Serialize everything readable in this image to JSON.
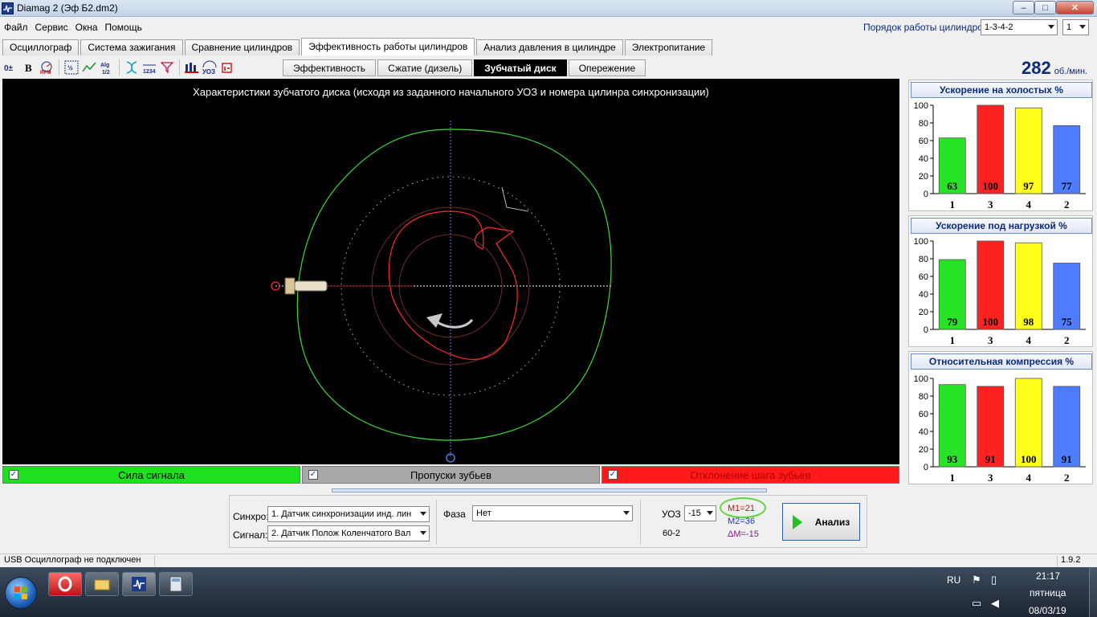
{
  "window": {
    "title": "Diamag 2 (Эф Б2.dm2)",
    "minimize": "‒",
    "maximize": "□",
    "close": "✕"
  },
  "menu": [
    "Файл",
    "Сервис",
    "Окна",
    "Помощь"
  ],
  "firing_order": {
    "label": "Порядок работы цилиндров",
    "value": "1-3-4-2",
    "spinner": "1"
  },
  "main_tabs": [
    "Осциллограф",
    "Система зажигания",
    "Сравнение цилиндров",
    "Эффективность работы цилиндров",
    "Анализ давления в цилиндре",
    "Электропитание"
  ],
  "main_tab_active": "Эффективность работы цилиндров",
  "toolbar": [
    "0±",
    "B",
    "RPM",
    "1/2",
    "~",
    "Alg",
    "dna",
    "1234",
    "filter",
    "bars",
    "УОЗ",
    "Ibat"
  ],
  "sub_tabs": [
    "Эффективность",
    "Сжатие (дизель)",
    "Зубчатый диск",
    "Опережение"
  ],
  "sub_tab_active": "Зубчатый диск",
  "rpm": {
    "value": "282",
    "unit": "об./мин."
  },
  "plot": {
    "title": "Характеристики зубчатого диска (исходя из заданного начального УОЗ и номера цилинра синхронизации)"
  },
  "legend": [
    {
      "label": "Сила сигнала",
      "color": "#1ee01e",
      "text_color": "#000000",
      "check": "✓"
    },
    {
      "label": "Пропуски зубьев",
      "color": "#a9a9a9",
      "text_color": "#000000",
      "check": "✓"
    },
    {
      "label": "Отклонение шага зубьев",
      "color": "#ff1a1a",
      "text_color": "#b30000",
      "check": "✓"
    }
  ],
  "controls": {
    "sync_label": "Синхро:",
    "sync_value": "1. Датчик синхронизации инд. лин",
    "signal_label": "Сигнал:",
    "signal_value": "2. Датчик Полож Коленчатого Вал",
    "phase_label": "Фаза",
    "phase_value": "Нет",
    "uoz_label": "УОЗ",
    "uoz_value": "-15",
    "disk_type": "60-2",
    "m1": "M1=21",
    "m2": "M2=36",
    "dm": "ΔM=-15",
    "analyze": "Анализ"
  },
  "status": {
    "left": "USB Осциллограф не подключен",
    "version": "1.9.2"
  },
  "taskbar": {
    "lang": "RU",
    "time": "21:17",
    "day": "пятница",
    "date": "08/03/19"
  },
  "charts": [
    {
      "title": "Ускорение на холостых %"
    },
    {
      "title": "Ускорение под нагрузкой %"
    },
    {
      "title": "Относительная компрессия %"
    }
  ],
  "chart_data": [
    {
      "type": "bar",
      "title": "Ускорение на холостых %",
      "categories": [
        "1",
        "3",
        "4",
        "2"
      ],
      "values": [
        63,
        100,
        97,
        77
      ],
      "ylim": [
        0,
        100
      ],
      "yticks": [
        0,
        20,
        40,
        60,
        80,
        100
      ],
      "colors": [
        "#27e427",
        "#ff2020",
        "#ffff1a",
        "#4d7cff"
      ]
    },
    {
      "type": "bar",
      "title": "Ускорение под нагрузкой %",
      "categories": [
        "1",
        "3",
        "4",
        "2"
      ],
      "values": [
        79,
        100,
        98,
        75
      ],
      "ylim": [
        0,
        100
      ],
      "yticks": [
        0,
        20,
        40,
        60,
        80,
        100
      ],
      "colors": [
        "#27e427",
        "#ff2020",
        "#ffff1a",
        "#4d7cff"
      ]
    },
    {
      "type": "bar",
      "title": "Относительная компрессия %",
      "categories": [
        "1",
        "3",
        "4",
        "2"
      ],
      "values": [
        93,
        91,
        100,
        91
      ],
      "ylim": [
        0,
        100
      ],
      "yticks": [
        0,
        20,
        40,
        60,
        80,
        100
      ],
      "colors": [
        "#27e427",
        "#ff2020",
        "#ffff1a",
        "#4d7cff"
      ]
    }
  ]
}
